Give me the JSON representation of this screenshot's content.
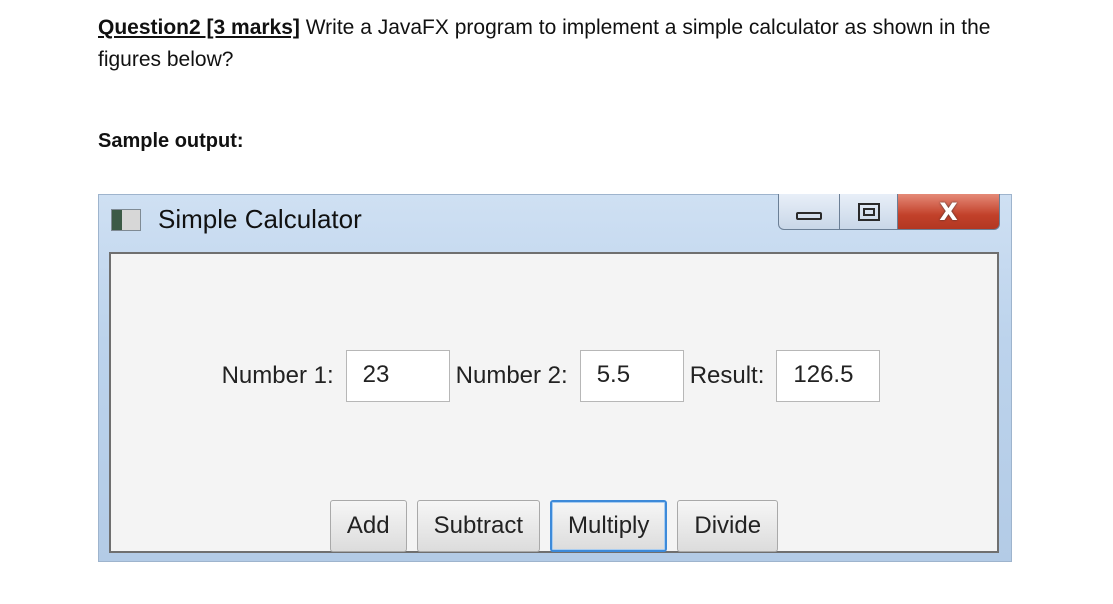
{
  "question": {
    "heading": "Question2 [3 marks]",
    "text": " Write a JavaFX program to implement a simple calculator as shown in the figures below?"
  },
  "sample_label": "Sample output:",
  "window": {
    "title": "Simple Calculator",
    "icons": {
      "app": "app-window-icon",
      "minimize": "minimize-icon",
      "maximize": "maximize-icon",
      "close": "close-icon"
    },
    "close_glyph": "X",
    "fields": {
      "number1_label": "Number 1:",
      "number1_value": "23",
      "number2_label": "Number 2:",
      "number2_value": "5.5",
      "result_label": "Result:",
      "result_value": "126.5"
    },
    "buttons": {
      "add": "Add",
      "subtract": "Subtract",
      "multiply": "Multiply",
      "divide": "Divide"
    },
    "colors": {
      "focus": "#3d8ad9",
      "close_button": "#c2412a",
      "titlebar": "#cfe0f3"
    }
  }
}
